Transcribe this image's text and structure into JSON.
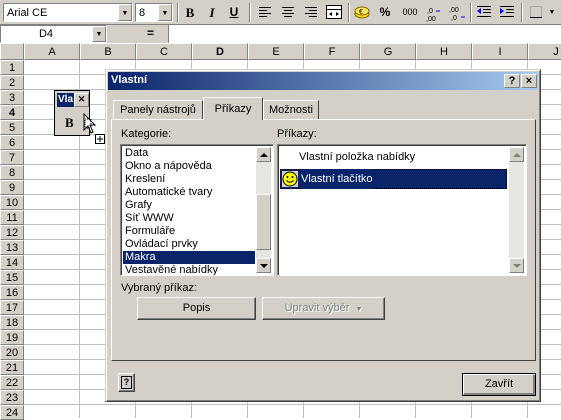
{
  "toolbar": {
    "font_name": "Arial CE",
    "font_size": "8",
    "bold_label": "B",
    "italic_label": "I",
    "underline_label": "U",
    "percent_label": "%",
    "thousands_label": "000",
    "inc_decimal_label": ",0 ,00",
    "dec_decimal_label": ",00 ,0"
  },
  "formula_bar": {
    "name_box": "D4",
    "equals": "=",
    "content": ""
  },
  "columns": [
    "A",
    "B",
    "C",
    "D",
    "E",
    "F",
    "G",
    "H",
    "I",
    "J"
  ],
  "active_column": "D",
  "rows": [
    "1",
    "2",
    "3",
    "4",
    "5",
    "6",
    "7",
    "8",
    "9",
    "10",
    "11",
    "12",
    "13",
    "14",
    "15",
    "16",
    "17",
    "18",
    "19",
    "20",
    "21",
    "22",
    "23",
    "24"
  ],
  "active_row": "4",
  "floating_toolbar": {
    "title": "Vla",
    "button_label": "B"
  },
  "dialog": {
    "title": "Vlastní",
    "help_label": "?",
    "close_label": "×",
    "tabs": [
      {
        "label": "Panely nástrojů"
      },
      {
        "label": "Příkazy"
      },
      {
        "label": "Možnosti"
      }
    ],
    "categories_label": "Kategorie:",
    "categories": [
      {
        "label": "Data"
      },
      {
        "label": "Okno a nápověda"
      },
      {
        "label": "Kreslení"
      },
      {
        "label": "Automatické tvary"
      },
      {
        "label": "Grafy"
      },
      {
        "label": "Síť WWW"
      },
      {
        "label": "Formuláře"
      },
      {
        "label": "Ovládací prvky"
      },
      {
        "label": "Makra"
      },
      {
        "label": "Vestavěné nabídky"
      }
    ],
    "selected_category": "Makra",
    "commands_label": "Příkazy:",
    "commands": [
      {
        "label": "Vlastní položka nabídky",
        "icon": "none"
      },
      {
        "label": "Vlastní tlačítko",
        "icon": "smiley-icon"
      }
    ],
    "selected_command": "Vlastní tlačítko",
    "selected_command_label": "Vybraný příkaz:",
    "describe_button": "Popis",
    "modify_selection_button": "Upravit výběr",
    "close_button": "Zavřít",
    "help_button": "?"
  },
  "colors": {
    "chrome": "#d4d0c8",
    "selection": "#0a246a",
    "title_gradient_end": "#a6caf0",
    "smiley": "#ffff00"
  }
}
